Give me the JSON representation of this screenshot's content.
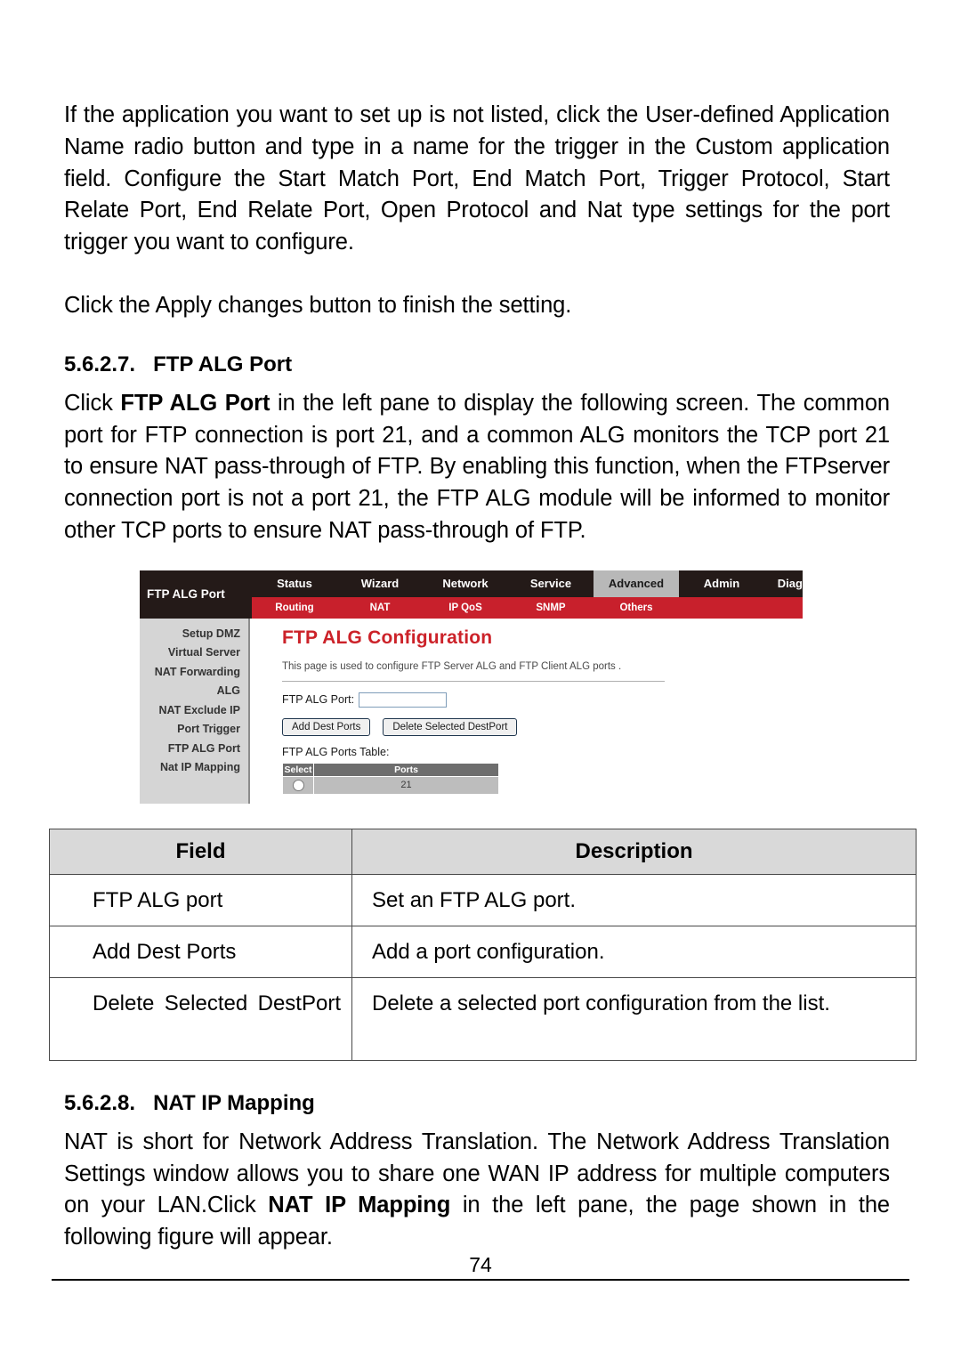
{
  "document": {
    "page_number": "74"
  },
  "paragraphs": {
    "intro": "If the application you want to set up is not listed, click the User-defined Application Name radio button and type in a name for the trigger in the Custom application field. Configure the Start Match Port, End Match Port, Trigger Protocol, Start Relate Port, End Relate Port, Open Protocol and Nat type settings for the port trigger you want to configure.",
    "apply": "Click the Apply changes button to finish the setting."
  },
  "section_ftp_alg": {
    "number": "5.6.2.7.",
    "title": "FTP ALG Port",
    "body_part1": "Click ",
    "body_bold": "FTP ALG Port",
    "body_part2": " in the left pane to display the following screen. The common port for FTP connection is port 21, and a common ALG monitors the TCP port 21 to ensure NAT pass-through of FTP. By enabling this function, when the FTPserver connection port is not a port 21, the FTP ALG module will be informed to monitor other TCP ports to ensure NAT pass-through of FTP."
  },
  "router_screenshot": {
    "brand_label": "FTP ALG Port",
    "main_tabs": [
      {
        "label": "Status",
        "active": false
      },
      {
        "label": "Wizard",
        "active": false
      },
      {
        "label": "Network",
        "active": false
      },
      {
        "label": "Service",
        "active": false
      },
      {
        "label": "Advanced",
        "active": true
      },
      {
        "label": "Admin",
        "active": false
      },
      {
        "label": "Diagnostic",
        "active": false
      }
    ],
    "sub_tabs": [
      {
        "label": "Routing"
      },
      {
        "label": "NAT"
      },
      {
        "label": "IP QoS"
      },
      {
        "label": "SNMP"
      },
      {
        "label": "Others"
      }
    ],
    "sidebar_items": [
      {
        "label": "Setup DMZ"
      },
      {
        "label": "Virtual Server"
      },
      {
        "label": "NAT Forwarding"
      },
      {
        "label": "ALG"
      },
      {
        "label": "NAT Exclude IP"
      },
      {
        "label": "Port Trigger"
      },
      {
        "label": "FTP ALG Port"
      },
      {
        "label": "Nat IP Mapping"
      }
    ],
    "panel": {
      "title": "FTP ALG Configuration",
      "description": "This page is used to configure FTP Server ALG and FTP Client ALG ports .",
      "field_label": "FTP ALG Port:",
      "field_value": "",
      "button_add": "Add Dest Ports",
      "button_delete": "Delete Selected DestPort",
      "table_label": "FTP ALG Ports Table:",
      "table_headers": [
        "Select",
        "Ports"
      ],
      "table_rows": [
        {
          "select": "",
          "ports": "21"
        }
      ]
    },
    "colors": {
      "topbar": "#241a18",
      "subbar": "#c8202c",
      "title": "#cc2229",
      "active_tab": "#b8b8b8",
      "sidebar": "#d5d5d5",
      "table_header": "#6e6e6e",
      "table_cell": "#bdbdbd"
    }
  },
  "field_table": {
    "headers": [
      "Field",
      "Description"
    ],
    "rows": [
      {
        "field": "FTP ALG port",
        "description": "Set an FTP ALG port."
      },
      {
        "field": "Add Dest Ports",
        "description": "Add a port configuration."
      },
      {
        "field": "Delete Selected DestPort",
        "description": "Delete a selected port configuration from the list."
      }
    ]
  },
  "section_nat_ip": {
    "number": "5.6.2.8.",
    "title": "NAT IP Mapping",
    "body_part1": "NAT is short for Network Address Translation. The Network Address Translation Settings window allows you to share one WAN IP address for multiple computers on your LAN.Click ",
    "body_bold": "NAT IP Mapping",
    "body_part2": " in the left pane, the page shown in the following figure will appear."
  }
}
